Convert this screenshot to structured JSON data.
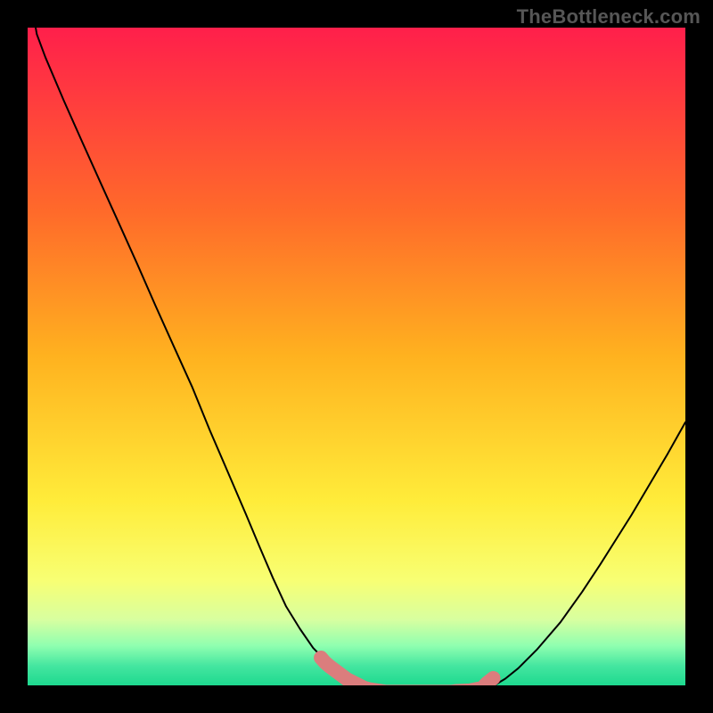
{
  "watermark": {
    "text": "TheBottleneck.com"
  },
  "colors": {
    "black": "#000000",
    "curve": "#000000",
    "highlight": "#db7d7d",
    "gradient_stops": [
      {
        "pct": 0,
        "color": "#ff1f4b"
      },
      {
        "pct": 28,
        "color": "#ff6a2a"
      },
      {
        "pct": 50,
        "color": "#ffb21f"
      },
      {
        "pct": 72,
        "color": "#ffec3a"
      },
      {
        "pct": 84,
        "color": "#f8ff73"
      },
      {
        "pct": 90,
        "color": "#d8ffa0"
      },
      {
        "pct": 94,
        "color": "#8fffb0"
      },
      {
        "pct": 97,
        "color": "#45e6a0"
      },
      {
        "pct": 100,
        "color": "#1ed98f"
      }
    ]
  },
  "chart_data": {
    "type": "line",
    "title": "",
    "xlabel": "",
    "ylabel": "",
    "xlim": [
      0,
      100
    ],
    "ylim": [
      0,
      100
    ],
    "series": [
      {
        "name": "bottleneck-curve",
        "x": [
          0.0,
          1.4,
          2.7,
          5.5,
          8.3,
          11.1,
          13.9,
          16.7,
          19.4,
          22.2,
          25.0,
          27.7,
          30.4,
          33.2,
          35.2,
          37.3,
          39.3,
          41.4,
          43.4,
          47.5,
          51.7,
          54.0,
          56.0,
          62.3,
          68.6,
          70.6,
          72.6,
          74.6,
          77.4,
          81.0,
          84.3,
          87.0,
          91.8,
          97.3,
          100.0
        ],
        "y": [
          107.0,
          99.0,
          95.5,
          88.9,
          82.6,
          76.4,
          70.2,
          64.0,
          57.8,
          51.6,
          45.4,
          38.8,
          32.5,
          26.0,
          21.2,
          16.3,
          12.0,
          8.6,
          5.7,
          1.5,
          -0.5,
          -1.0,
          -1.0,
          -1.0,
          -1.0,
          -0.2,
          1.0,
          2.6,
          5.4,
          9.6,
          14.2,
          18.3,
          25.9,
          35.2,
          40.0
        ]
      }
    ],
    "annotations": [
      {
        "name": "valley-highlight",
        "type": "thick-segment",
        "x": [
          44.6,
          45.2,
          45.9,
          48.6,
          51.2,
          51.9,
          54.5,
          57.2,
          60.5,
          63.8,
          64.5,
          65.1,
          67.2,
          69.1,
          69.8,
          70.8
        ],
        "y": [
          4.2,
          3.5,
          2.9,
          0.9,
          -0.4,
          -0.6,
          -1.0,
          -1.0,
          -1.0,
          -1.0,
          -1.0,
          -0.9,
          -0.8,
          -0.4,
          0.3,
          1.1
        ]
      }
    ]
  }
}
